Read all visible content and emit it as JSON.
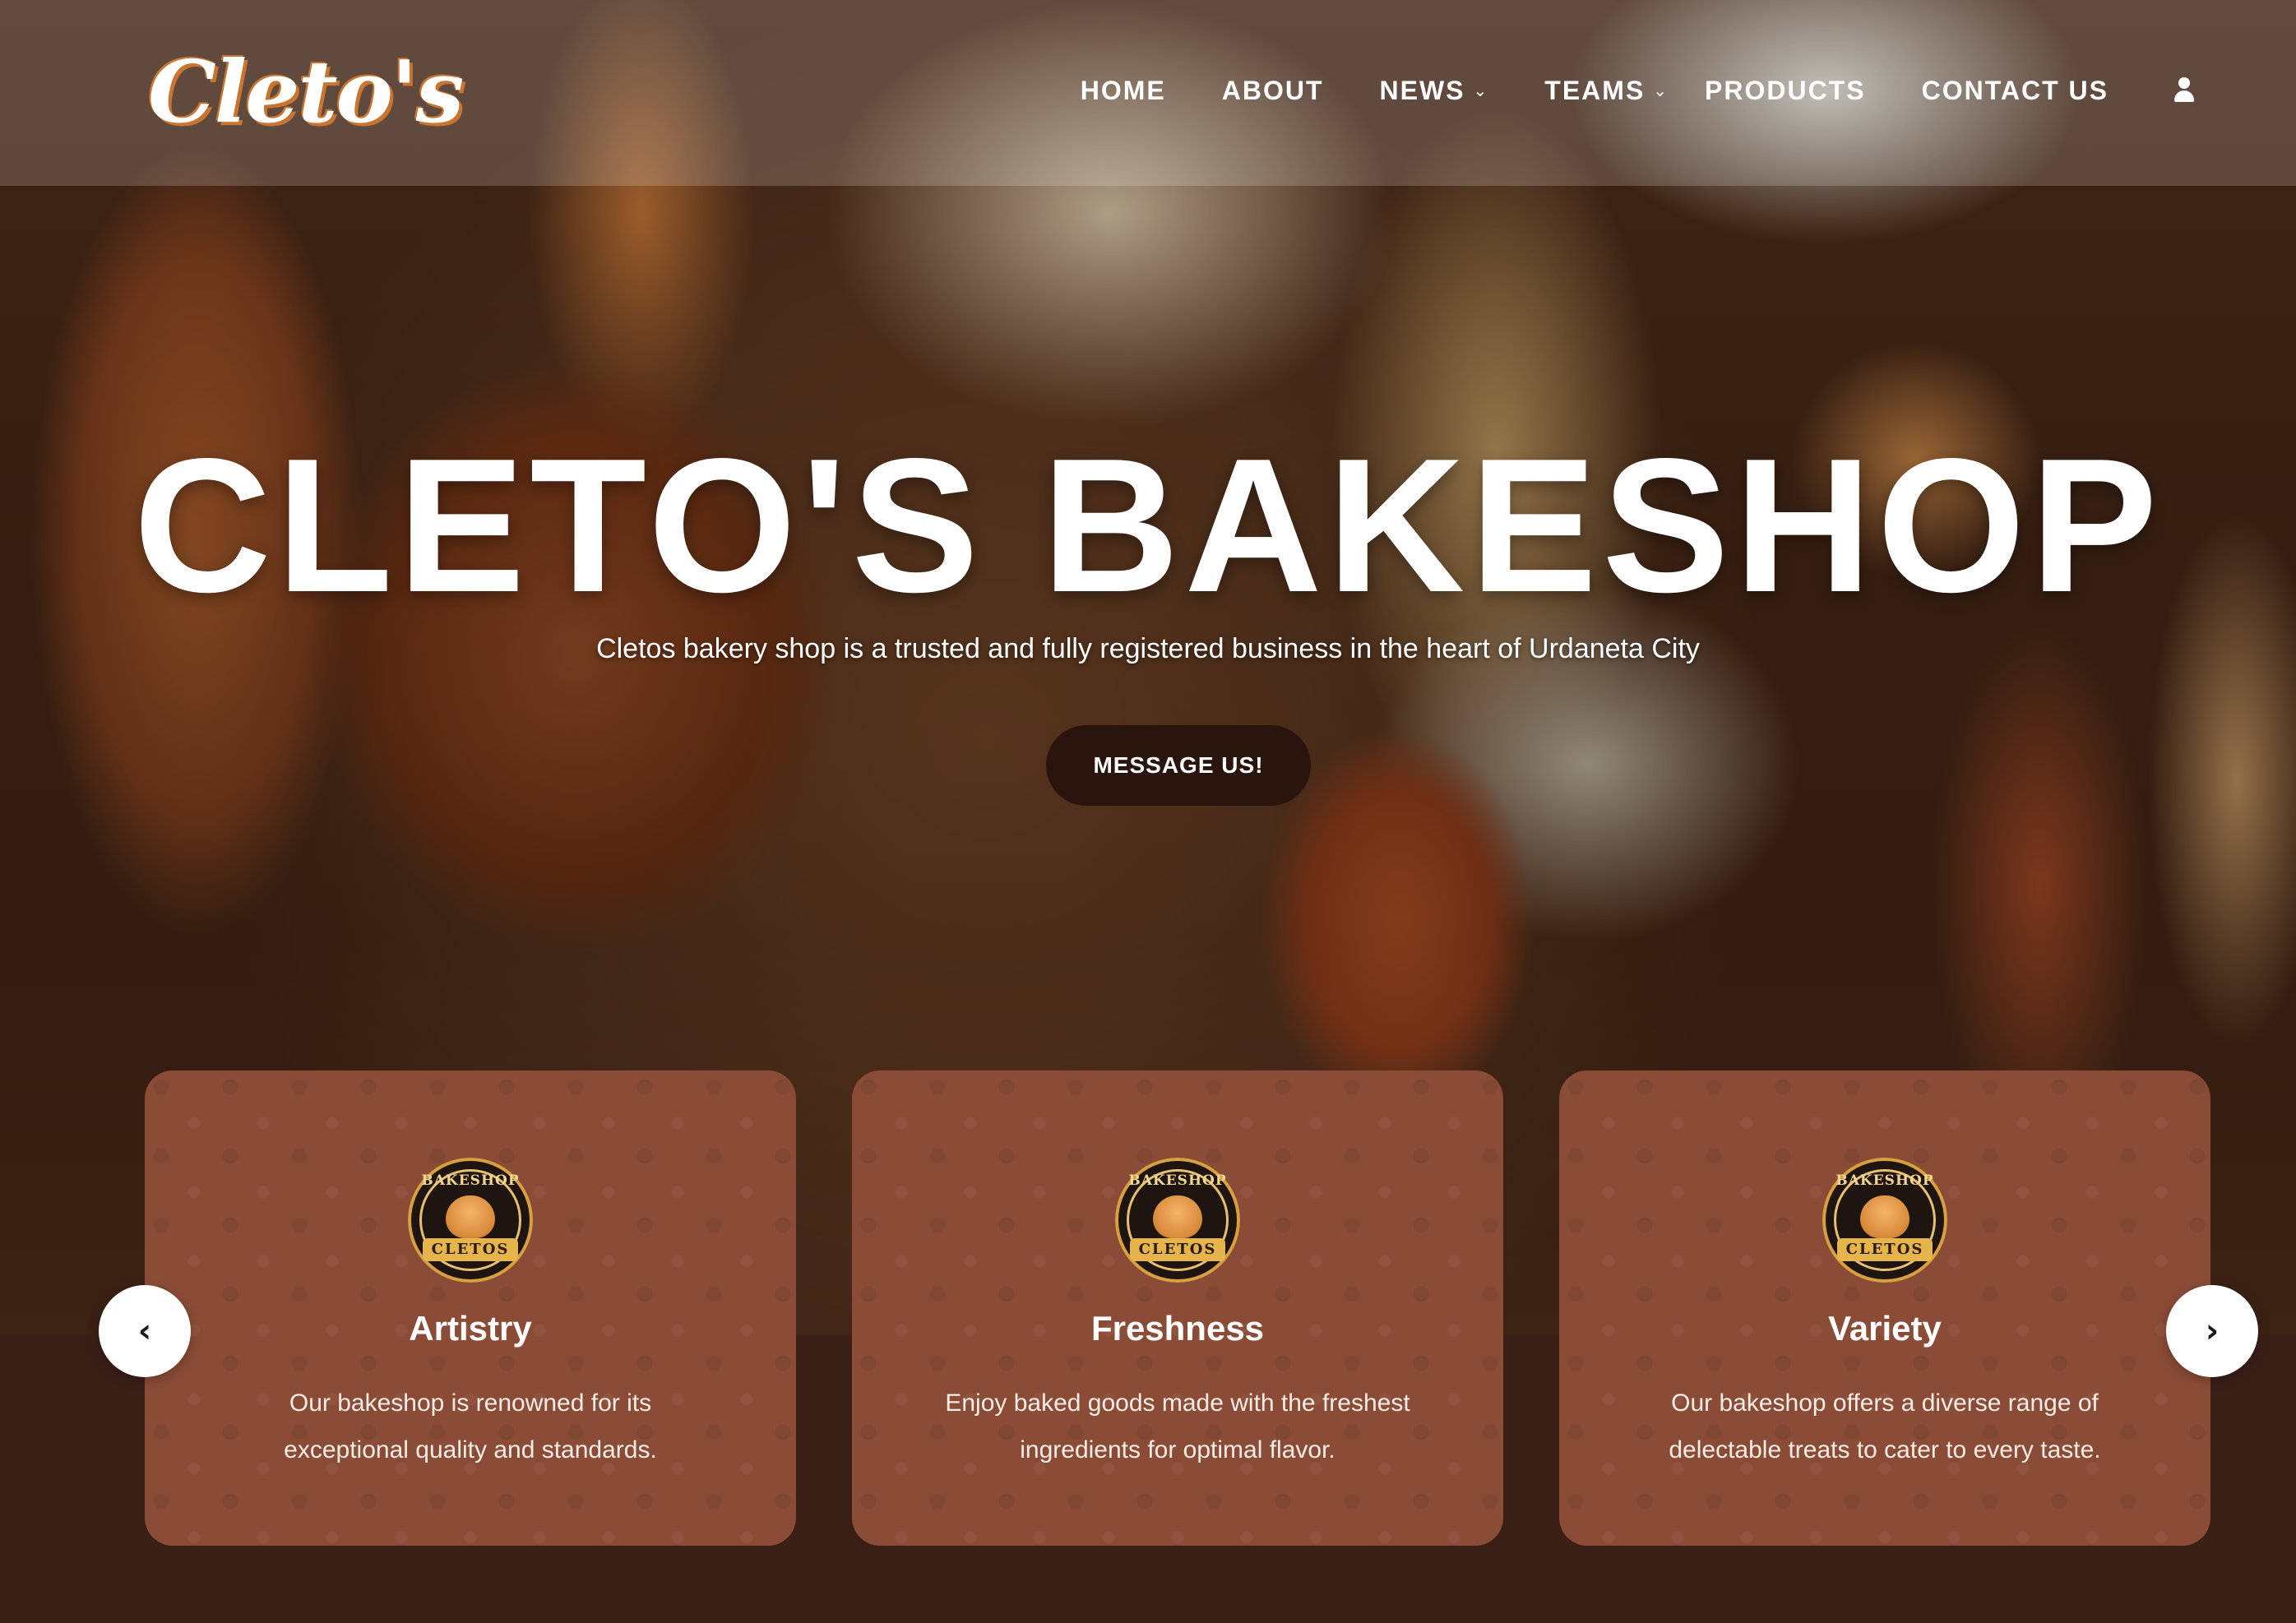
{
  "brand": {
    "logo_text": "Cleto's"
  },
  "nav": {
    "items": [
      {
        "label": "HOME",
        "has_dropdown": false
      },
      {
        "label": "ABOUT",
        "has_dropdown": false
      },
      {
        "label": "NEWS",
        "has_dropdown": true
      },
      {
        "label": "TEAMS",
        "has_dropdown": true
      },
      {
        "label": "PRODUCTS",
        "has_dropdown": false
      },
      {
        "label": "CONTACT US",
        "has_dropdown": false
      }
    ],
    "user_icon": "user-icon"
  },
  "hero": {
    "title": "CLETO'S BAKESHOP",
    "subtitle": "Cletos bakery shop is a trusted and fully registered business in the heart of Urdaneta City",
    "cta_label": "MESSAGE US!"
  },
  "features": [
    {
      "title": "Artistry",
      "text": "Our bakeshop is renowned for its exceptional quality and standards."
    },
    {
      "title": "Freshness",
      "text": "Enjoy baked goods made with the freshest ingredients for optimal flavor."
    },
    {
      "title": "Variety",
      "text": "Our bakeshop offers a diverse range of delectable treats to cater to every taste."
    }
  ],
  "badge": {
    "top_text": "BAKESHOP",
    "ribbon_text": "CLETOS"
  },
  "carousel": {
    "prev_icon": "chevron-left-icon",
    "next_icon": "chevron-right-icon"
  },
  "colors": {
    "card_bg": "#8a4c37",
    "dark_band": "#3a1f17",
    "cta_bg": "#2a140e",
    "logo_accent": "#c9742f"
  }
}
